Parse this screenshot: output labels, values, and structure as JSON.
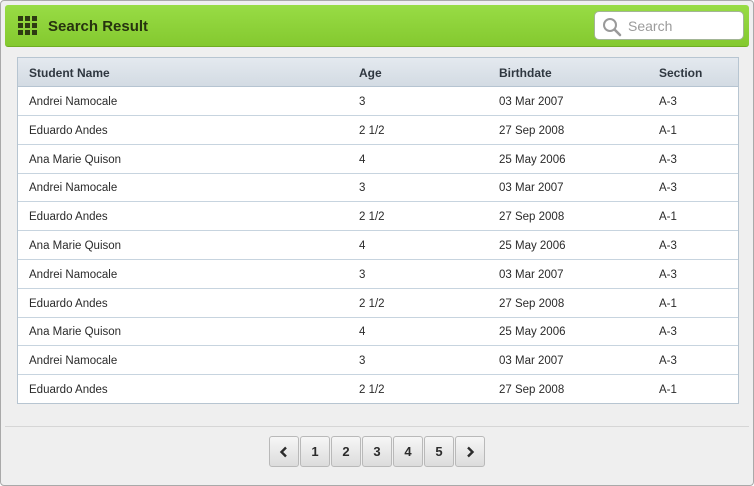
{
  "header": {
    "title": "Search Result",
    "search_placeholder": "Search"
  },
  "table": {
    "columns": [
      "Student Name",
      "Age",
      "Birthdate",
      "Section"
    ],
    "rows": [
      [
        "Andrei Namocale",
        "3",
        "03 Mar 2007",
        "A-3"
      ],
      [
        "Eduardo Andes",
        "2 1/2",
        "27 Sep 2008",
        "A-1"
      ],
      [
        "Ana Marie Quison",
        "4",
        "25 May 2006",
        "A-3"
      ],
      [
        "Andrei Namocale",
        "3",
        "03 Mar 2007",
        "A-3"
      ],
      [
        "Eduardo Andes",
        "2 1/2",
        "27 Sep 2008",
        "A-1"
      ],
      [
        "Ana Marie Quison",
        "4",
        "25 May 2006",
        "A-3"
      ],
      [
        "Andrei Namocale",
        "3",
        "03 Mar 2007",
        "A-3"
      ],
      [
        "Eduardo Andes",
        "2 1/2",
        "27 Sep 2008",
        "A-1"
      ],
      [
        "Ana Marie Quison",
        "4",
        "25 May 2006",
        "A-3"
      ],
      [
        "Andrei Namocale",
        "3",
        "03 Mar 2007",
        "A-3"
      ],
      [
        "Eduardo Andes",
        "2 1/2",
        "27 Sep 2008",
        "A-1"
      ]
    ]
  },
  "pagination": {
    "prev_icon": "chevron-left-icon",
    "next_icon": "chevron-right-icon",
    "pages": [
      "1",
      "2",
      "3",
      "4",
      "5"
    ]
  },
  "colors": {
    "header_green": "#8fd43e",
    "table_header": "#dbe1e8",
    "row_border": "#c7d4df"
  }
}
